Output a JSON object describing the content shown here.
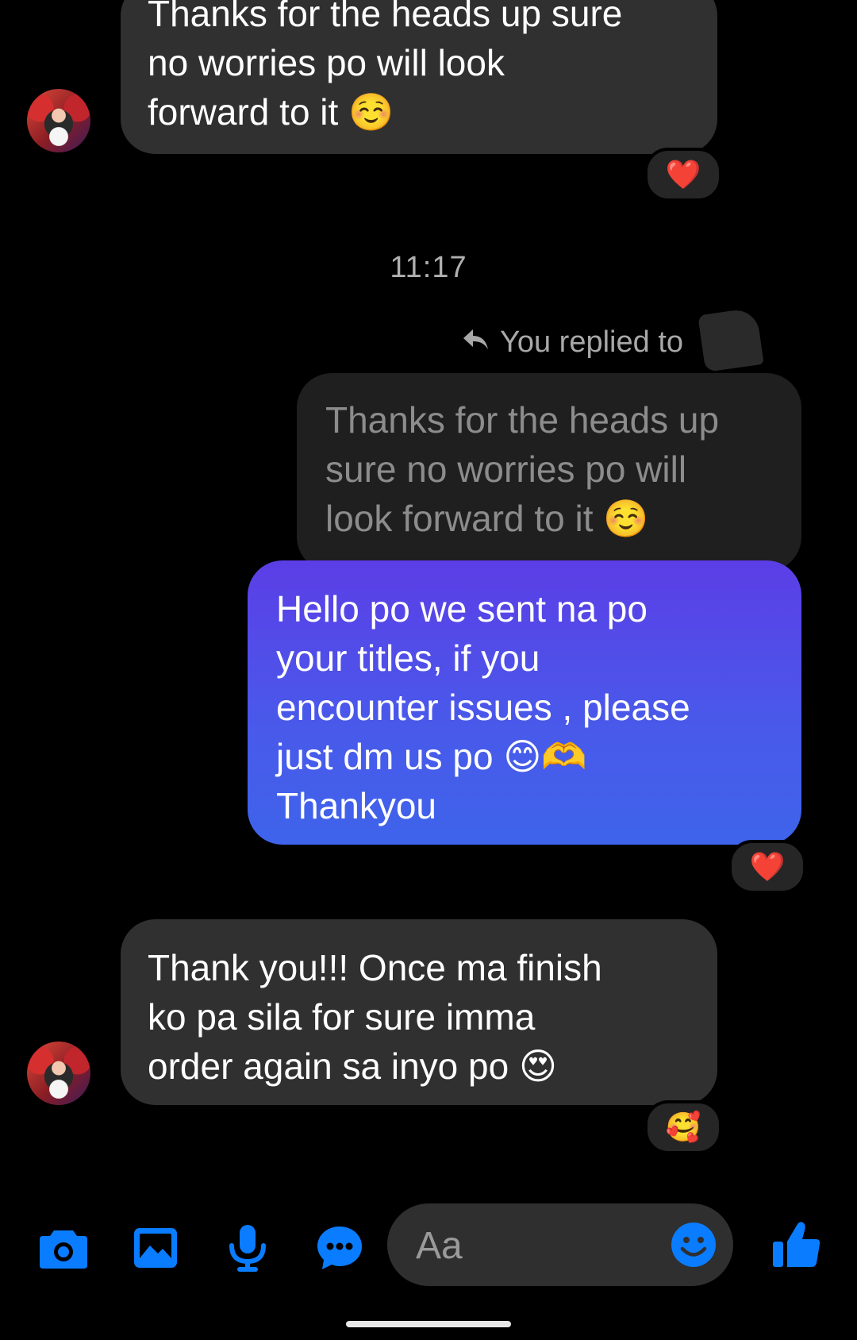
{
  "messages": {
    "first_incoming": "Thanks for the heads up sure\nno worries po will look\nforward to it ☺️",
    "first_reaction": "❤️",
    "timestamp": "11:17",
    "reply_label": "You replied to",
    "quoted_message": "Thanks for the heads up\nsure no worries po will\nlook forward to it ☺️",
    "outgoing_message": "Hello po we sent na po\nyour titles, if you\nencounter issues , please\njust dm us po 😊🫶\nThankyou",
    "outgoing_reaction": "❤️",
    "last_incoming": "Thank you!!! Once ma finish\nko pa sila for sure imma\norder again sa inyo po 😍",
    "last_reaction": "🥰"
  },
  "composer": {
    "placeholder": "Aa"
  },
  "toolbar": {
    "icons": [
      "camera-icon",
      "gallery-icon",
      "microphone-icon",
      "chat-bubble-icon",
      "emoji-icon",
      "thumbs-up-icon"
    ],
    "accent_color": "#0a7cff"
  },
  "colors": {
    "background": "#000000",
    "incoming_bubble": "#303030",
    "outgoing_bubble_top": "#5b3ee6",
    "outgoing_bubble_bottom": "#3e64eb"
  }
}
